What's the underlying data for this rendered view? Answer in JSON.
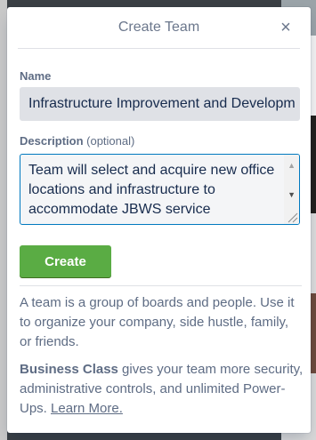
{
  "header": {
    "title": "Create Team",
    "close_glyph": "×"
  },
  "form": {
    "name_label": "Name",
    "name_value": "Infrastructure Improvement and Developm",
    "description_label": "Description",
    "description_optional": "(optional)",
    "description_value": "Team will select and acquire new office locations and infrastructure to accommodate JBWS service",
    "create_label": "Create"
  },
  "info": {
    "paragraph1": "A team is a group of boards and people. Use it to organize your company, side hustle, family, or friends.",
    "business_class": "Business Class",
    "paragraph2_rest": " gives your team more security, administrative controls, and unlimited Power-Ups. ",
    "learn_more": "Learn More."
  },
  "colors": {
    "create_button": "#5aac44",
    "focus_border": "#0079bf"
  }
}
